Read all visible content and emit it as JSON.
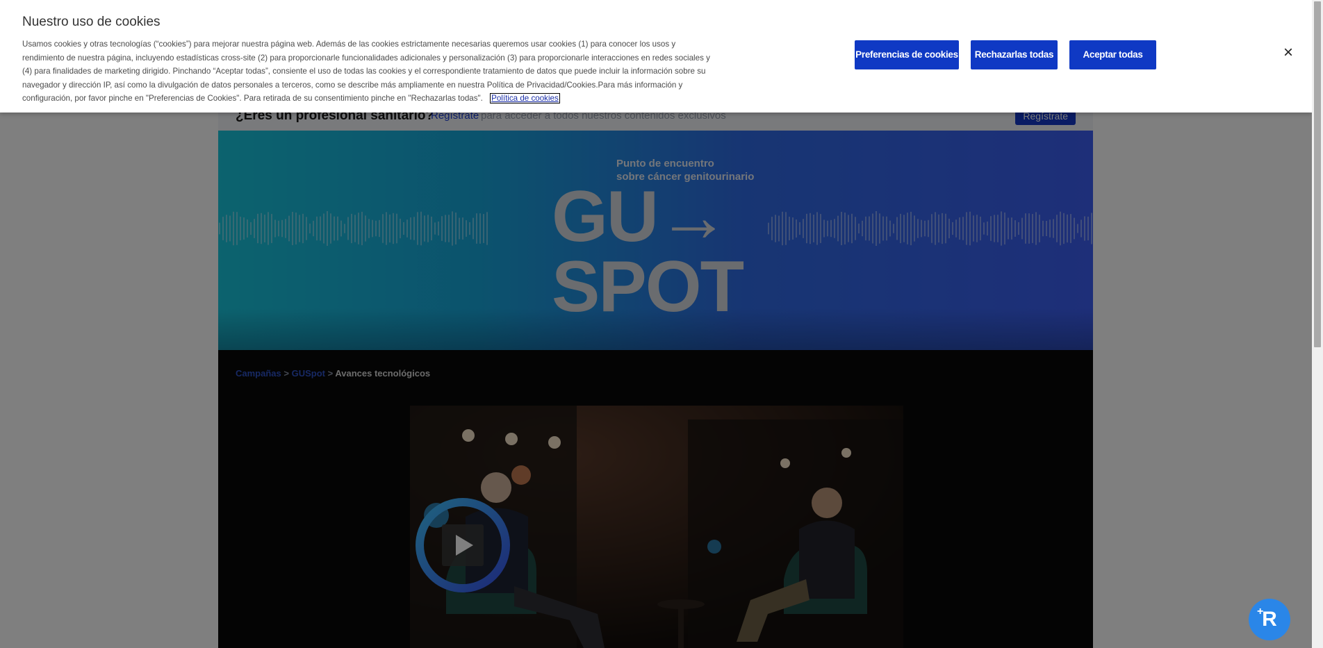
{
  "cookie_banner": {
    "title": "Nuestro uso de cookies",
    "body": "Usamos cookies y otras tecnologías (“cookies”) para mejorar nuestra página web. Además de las cookies estrictamente necesarias queremos usar cookies (1) para conocer los usos y rendimiento de nuestra página, incluyendo estadísticas cross-site (2) para proporcionarle funcionalidades adicionales y personalización (3) para proporcionarle interacciones en redes sociales y (4) para finalidades de marketing dirigido. Pinchando “Aceptar todas”, consiente el uso de todas las cookies y el correspondiente tratamiento de datos que puede incluir la información sobre su navegador y dirección IP, así como la divulgación de datos personales a terceros, como se describe más ampliamente en nuestra Política de Privacidad/Cookies.Para más información y configuración, por favor pinche en \"Preferencias de Cookies\". Para retirada de su consentimiento pinche en \"Rechazarlas todas\".",
    "policy_link": "Política de cookies",
    "buttons": {
      "preferences": "Preferencias de cookies",
      "reject_all": "Rechazarlas todas",
      "accept_all": "Aceptar todas"
    },
    "close_icon": "×"
  },
  "hcp_bar": {
    "title": "¿Eres un profesional sanitario?",
    "link": "Regístrate",
    "rest": "para acceder a todos nuestros contenidos exclusivos",
    "button": "Regístrate"
  },
  "banner": {
    "subtitle_line1": "Punto de encuentro",
    "subtitle_line2": "sobre cáncer genitourinario",
    "logo_line1": "GU→",
    "logo_line2": "SPOT"
  },
  "breadcrumb": {
    "items": [
      "Campañas",
      "GUSpot",
      "Avances tecnológicos"
    ],
    "separator": ">"
  },
  "colors": {
    "primary_button": "#0f39c4",
    "overlay": "rgba(0,0,0,0.5)",
    "fab": "#2a86e8"
  },
  "icons": {
    "close": "close-icon",
    "play": "play-icon",
    "fab": "assistant-icon"
  }
}
